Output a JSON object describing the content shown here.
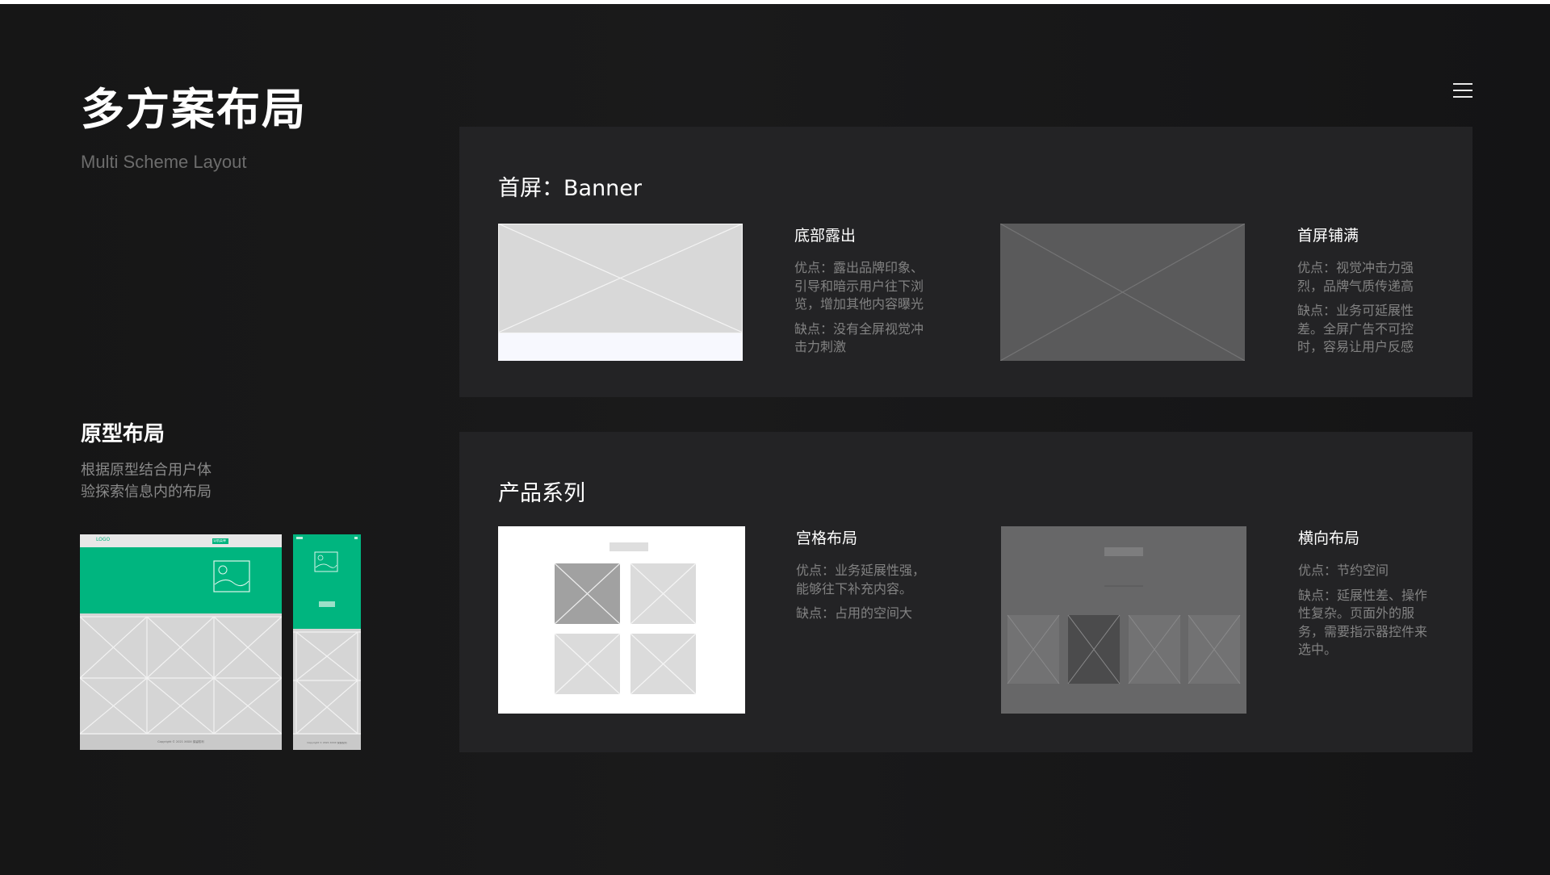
{
  "header": {
    "title": "多方案布局",
    "subtitle": "Multi Scheme Layout"
  },
  "prototype": {
    "title": "原型布局",
    "desc_lines": [
      "根据原型结合用户体",
      "验探索信息内的布局"
    ],
    "desktop_logo": "LOGO",
    "desktop_button": "导航菜单",
    "footer_text": "Copyright © 2021 XXXX 保留权利"
  },
  "sections": [
    {
      "title": "首屏：Banner",
      "items": [
        {
          "title": "底部露出",
          "pros": "优点：露出品牌印象、引导和暗示用户往下浏览，增加其他内容曝光",
          "cons": "缺点：没有全屏视觉冲击力刺激"
        },
        {
          "title": "首屏铺满",
          "pros": "优点：视觉冲击力强烈，品牌气质传递高",
          "cons": "缺点：业务可延展性差。全屏广告不可控时，容易让用户反感"
        }
      ]
    },
    {
      "title": "产品系列",
      "items": [
        {
          "title": "宫格布局",
          "pros": "优点：业务延展性强，能够往下补充内容。",
          "cons": "缺点：占用的空间大"
        },
        {
          "title": "横向布局",
          "pros": "优点：节约空间",
          "cons": "缺点：延展性差、操作性复杂。页面外的服务，需要指示器控件来选中。"
        }
      ]
    }
  ],
  "colors": {
    "background": "#161616",
    "panel": "#232325",
    "accent_green": "#00b57f",
    "text_muted": "#828282"
  },
  "icons": {
    "menu": "hamburger-menu-icon"
  }
}
